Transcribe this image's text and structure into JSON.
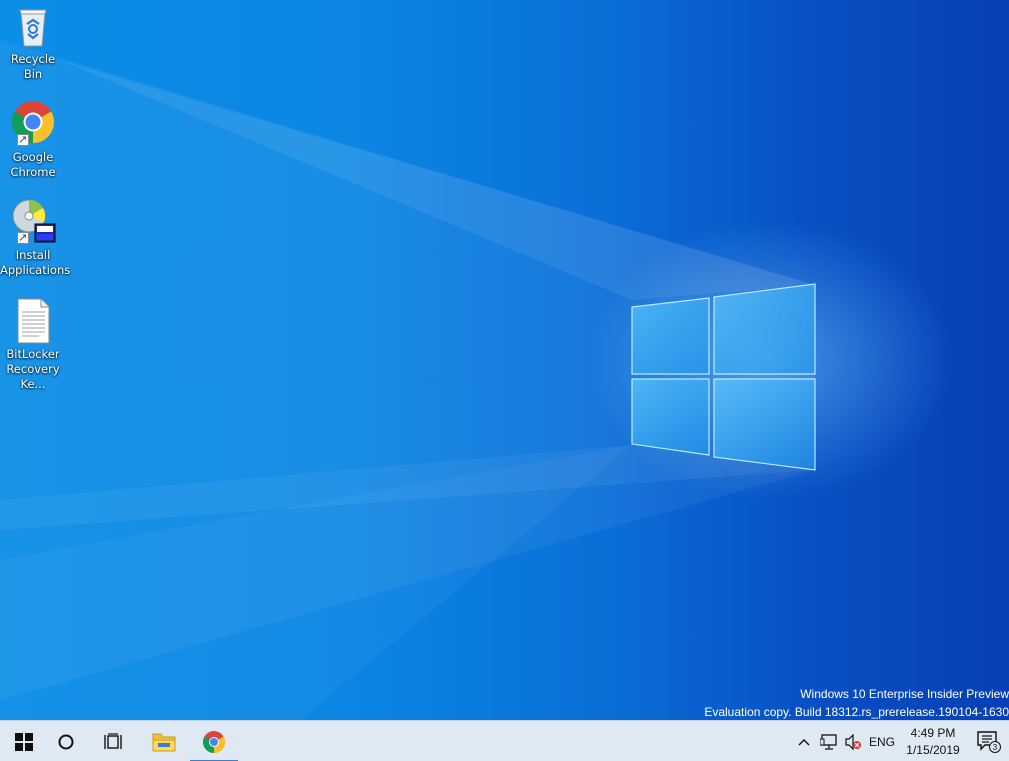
{
  "desktop": {
    "icons": [
      {
        "label": "Recycle Bin",
        "icon": "recycle-bin-icon"
      },
      {
        "label": "Google\nChrome",
        "icon": "chrome-icon"
      },
      {
        "label": "Install\nApplications",
        "icon": "installer-icon"
      },
      {
        "label": "BitLocker\nRecovery Ke...",
        "icon": "text-document-icon"
      }
    ],
    "watermark": {
      "line1": "Windows 10 Enterprise Insider Preview",
      "line2": "Evaluation copy. Build 18312.rs_prerelease.190104-1630"
    }
  },
  "taskbar": {
    "buttons": [
      {
        "name": "start-button",
        "icon": "windows-logo-icon"
      },
      {
        "name": "search-button",
        "icon": "cortana-circle-icon"
      },
      {
        "name": "task-view-button",
        "icon": "task-view-icon"
      },
      {
        "name": "file-explorer-button",
        "icon": "folder-icon"
      },
      {
        "name": "chrome-taskbar-button",
        "icon": "chrome-icon",
        "active": true
      }
    ],
    "tray": {
      "language": "ENG",
      "time": "4:49 PM",
      "date": "1/15/2019",
      "notification_count": "3"
    }
  },
  "colors": {
    "desktop_left": "#0a8ee6",
    "desktop_right": "#0640b4",
    "taskbar": "#dfe9f3",
    "active_indicator": "#3f7fd0"
  }
}
